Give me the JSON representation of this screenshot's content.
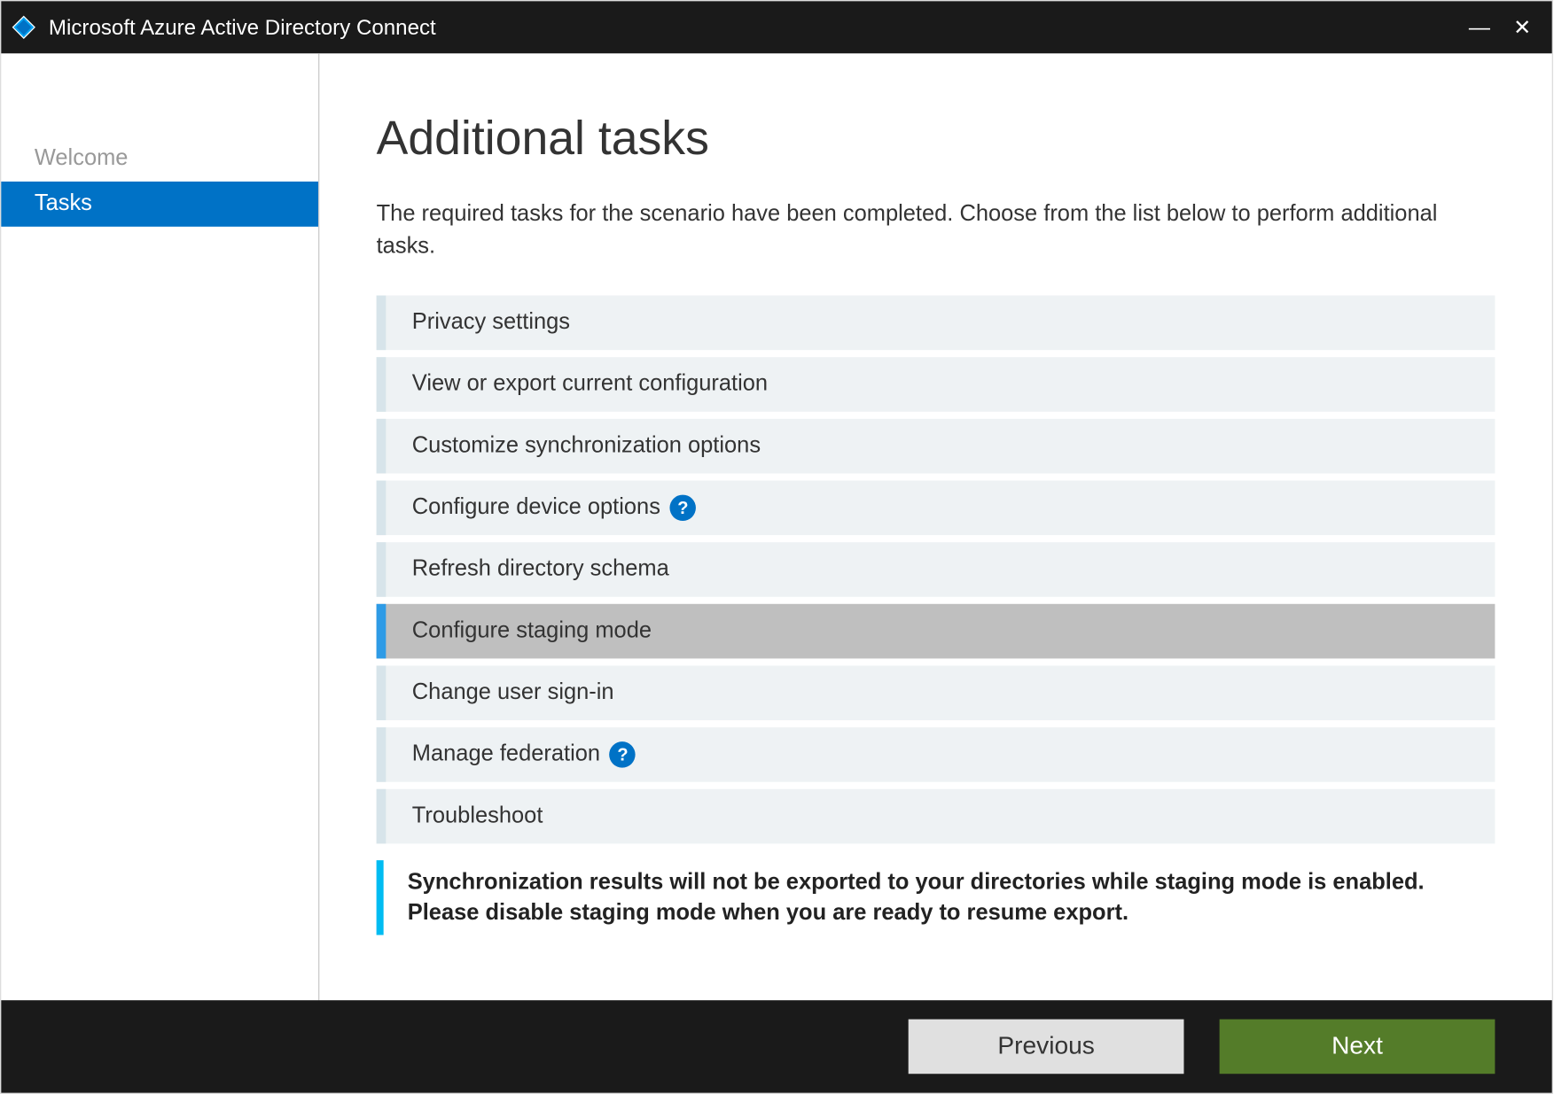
{
  "window": {
    "title": "Microsoft Azure Active Directory Connect"
  },
  "sidebar": {
    "items": [
      {
        "label": "Welcome",
        "active": false
      },
      {
        "label": "Tasks",
        "active": true
      }
    ]
  },
  "main": {
    "title": "Additional tasks",
    "description": "The required tasks for the scenario have been completed. Choose from the list below to perform additional tasks.",
    "tasks": [
      {
        "label": "Privacy settings",
        "help": false,
        "selected": false
      },
      {
        "label": "View or export current configuration",
        "help": false,
        "selected": false
      },
      {
        "label": "Customize synchronization options",
        "help": false,
        "selected": false
      },
      {
        "label": "Configure device options",
        "help": true,
        "selected": false
      },
      {
        "label": "Refresh directory schema",
        "help": false,
        "selected": false
      },
      {
        "label": "Configure staging mode",
        "help": false,
        "selected": true
      },
      {
        "label": "Change user sign-in",
        "help": false,
        "selected": false
      },
      {
        "label": "Manage federation",
        "help": true,
        "selected": false
      },
      {
        "label": "Troubleshoot",
        "help": false,
        "selected": false
      }
    ],
    "info": "Synchronization results will not be exported to your directories while staging mode is enabled. Please disable staging mode when you are ready to resume export."
  },
  "footer": {
    "previous": "Previous",
    "next": "Next"
  },
  "icons": {
    "help_glyph": "?",
    "close_glyph": "✕",
    "minimize_glyph": "—"
  }
}
